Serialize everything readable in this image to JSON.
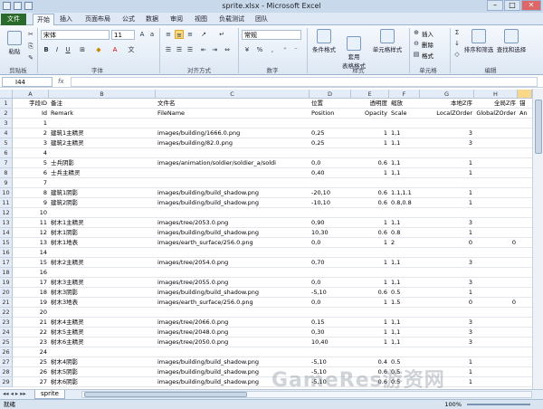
{
  "window": {
    "title": "sprite.xlsx - Microsoft Excel",
    "minimize": "–",
    "maximize": "□",
    "close": "✕"
  },
  "tabs": [
    "文件",
    "开始",
    "插入",
    "页面布局",
    "公式",
    "数据",
    "审阅",
    "视图",
    "负载测试",
    "团队"
  ],
  "ribbon": {
    "paste": "粘贴",
    "clipboard": "剪贴板",
    "font_name": "宋体",
    "font_size": "11",
    "font_group": "字体",
    "align_group": "对齐方式",
    "number_format": "常规",
    "number_group": "数字",
    "cond_format": "条件格式",
    "table_format": "套用\n表格格式",
    "cell_style": "单元格样式",
    "style_group": "样式",
    "insert": "插入",
    "delete": "删除",
    "format": "格式",
    "cells_group": "单元格",
    "sort_filter": "排序和筛选",
    "find_select": "查找和选择",
    "edit_group": "编辑"
  },
  "formula_bar": {
    "name_box": "I44",
    "fx": "fx",
    "value": ""
  },
  "columns": [
    "A",
    "B",
    "C",
    "D",
    "E",
    "F",
    "G",
    "H",
    ""
  ],
  "rows": [
    {
      "n": "1",
      "a": "字段ID",
      "b": "备注",
      "c": "文件名",
      "d": "位置",
      "e": "透明度",
      "f": "缩放",
      "g": "本地Z序",
      "h": "全局Z序",
      "i": "锚"
    },
    {
      "n": "2",
      "a": "Id",
      "b": "Remark",
      "c": "FileName",
      "d": "Position",
      "e": "Opacity",
      "f": "Scale",
      "g": "LocalZOrder",
      "h": "GlobalZOrder",
      "i": "An"
    },
    {
      "n": "3",
      "a": "1",
      "b": "",
      "c": "",
      "d": "",
      "e": "",
      "f": "",
      "g": "",
      "h": "",
      "i": ""
    },
    {
      "n": "4",
      "a": "2",
      "b": "建筑1主精灵",
      "c": "images/building/1666.0.png",
      "d": "0,25",
      "e": "1",
      "f": "1,1",
      "g": "3",
      "h": "",
      "i": ""
    },
    {
      "n": "5",
      "a": "3",
      "b": "建筑2主精灵",
      "c": "images/building/82.0.png",
      "d": "0,25",
      "e": "1",
      "f": "1,1",
      "g": "3",
      "h": "",
      "i": ""
    },
    {
      "n": "6",
      "a": "4",
      "b": "",
      "c": "",
      "d": "",
      "e": "",
      "f": "",
      "g": "",
      "h": "",
      "i": ""
    },
    {
      "n": "7",
      "a": "5",
      "b": "士兵阴影",
      "c": "images/animation/soldier/soldier_a/soldi",
      "d": "0,0",
      "e": "0.6",
      "f": "1,1",
      "g": "1",
      "h": "",
      "i": ""
    },
    {
      "n": "8",
      "a": "6",
      "b": "士兵主精灵",
      "c": "",
      "d": "0,40",
      "e": "1",
      "f": "1,1",
      "g": "1",
      "h": "",
      "i": ""
    },
    {
      "n": "9",
      "a": "7",
      "b": "",
      "c": "",
      "d": "",
      "e": "",
      "f": "",
      "g": "",
      "h": "",
      "i": ""
    },
    {
      "n": "10",
      "a": "8",
      "b": "建筑1阴影",
      "c": "images/building/build_shadow.png",
      "d": "-20,10",
      "e": "0.6",
      "f": "1.1,1.1",
      "g": "1",
      "h": "",
      "i": ""
    },
    {
      "n": "11",
      "a": "9",
      "b": "建筑2阴影",
      "c": "images/building/build_shadow.png",
      "d": "-10,10",
      "e": "0.6",
      "f": "0.8,0.8",
      "g": "1",
      "h": "",
      "i": ""
    },
    {
      "n": "12",
      "a": "10",
      "b": "",
      "c": "",
      "d": "",
      "e": "",
      "f": "",
      "g": "",
      "h": "",
      "i": ""
    },
    {
      "n": "13",
      "a": "11",
      "b": "树木1主精灵",
      "c": "images/tree/2053.0.png",
      "d": "0,90",
      "e": "1",
      "f": "1,1",
      "g": "3",
      "h": "",
      "i": ""
    },
    {
      "n": "14",
      "a": "12",
      "b": "树木1阴影",
      "c": "images/building/build_shadow.png",
      "d": "10,30",
      "e": "0.6",
      "f": "0.8",
      "g": "1",
      "h": "",
      "i": ""
    },
    {
      "n": "15",
      "a": "13",
      "b": "树木1地表",
      "c": "images/earth_surface/256.0.png",
      "d": "0,0",
      "e": "1",
      "f": "2",
      "g": "0",
      "h": "0",
      "i": ""
    },
    {
      "n": "16",
      "a": "14",
      "b": "",
      "c": "",
      "d": "",
      "e": "",
      "f": "",
      "g": "",
      "h": "",
      "i": ""
    },
    {
      "n": "17",
      "a": "15",
      "b": "树木2主精灵",
      "c": "images/tree/2054.0.png",
      "d": "0,70",
      "e": "1",
      "f": "1,1",
      "g": "3",
      "h": "",
      "i": ""
    },
    {
      "n": "18",
      "a": "16",
      "b": "",
      "c": "",
      "d": "",
      "e": "",
      "f": "",
      "g": "",
      "h": "",
      "i": ""
    },
    {
      "n": "19",
      "a": "17",
      "b": "树木3主精灵",
      "c": "images/tree/2055.0.png",
      "d": "0,0",
      "e": "1",
      "f": "1,1",
      "g": "3",
      "h": "",
      "i": ""
    },
    {
      "n": "20",
      "a": "18",
      "b": "树木3阴影",
      "c": "images/building/build_shadow.png",
      "d": "-5,10",
      "e": "0.6",
      "f": "0.5",
      "g": "1",
      "h": "",
      "i": ""
    },
    {
      "n": "21",
      "a": "19",
      "b": "树木3地表",
      "c": "images/earth_surface/256.0.png",
      "d": "0,0",
      "e": "1",
      "f": "1.5",
      "g": "0",
      "h": "0",
      "i": ""
    },
    {
      "n": "22",
      "a": "20",
      "b": "",
      "c": "",
      "d": "",
      "e": "",
      "f": "",
      "g": "",
      "h": "",
      "i": ""
    },
    {
      "n": "23",
      "a": "21",
      "b": "树木4主精灵",
      "c": "images/tree/2066.0.png",
      "d": "0,15",
      "e": "1",
      "f": "1,1",
      "g": "3",
      "h": "",
      "i": ""
    },
    {
      "n": "24",
      "a": "22",
      "b": "树木5主精灵",
      "c": "images/tree/2048.0.png",
      "d": "0,30",
      "e": "1",
      "f": "1,1",
      "g": "3",
      "h": "",
      "i": ""
    },
    {
      "n": "25",
      "a": "23",
      "b": "树木6主精灵",
      "c": "images/tree/2050.0.png",
      "d": "10,40",
      "e": "1",
      "f": "1,1",
      "g": "3",
      "h": "",
      "i": ""
    },
    {
      "n": "26",
      "a": "24",
      "b": "",
      "c": "",
      "d": "",
      "e": "",
      "f": "",
      "g": "",
      "h": "",
      "i": ""
    },
    {
      "n": "27",
      "a": "25",
      "b": "树木4阴影",
      "c": "images/building/build_shadow.png",
      "d": "-5,10",
      "e": "0.4",
      "f": "0.5",
      "g": "1",
      "h": "",
      "i": ""
    },
    {
      "n": "28",
      "a": "26",
      "b": "树木5阴影",
      "c": "images/building/build_shadow.png",
      "d": "-5,10",
      "e": "0.6",
      "f": "0.5",
      "g": "1",
      "h": "",
      "i": ""
    },
    {
      "n": "29",
      "a": "27",
      "b": "树木6阴影",
      "c": "images/building/build_shadow.png",
      "d": "-5,10",
      "e": "0.6",
      "f": "0.5",
      "g": "1",
      "h": "",
      "i": ""
    }
  ],
  "sheet_tab": "sprite",
  "status": {
    "left": "就绪",
    "zoom": "100%"
  },
  "watermark": "GameRes游资网"
}
